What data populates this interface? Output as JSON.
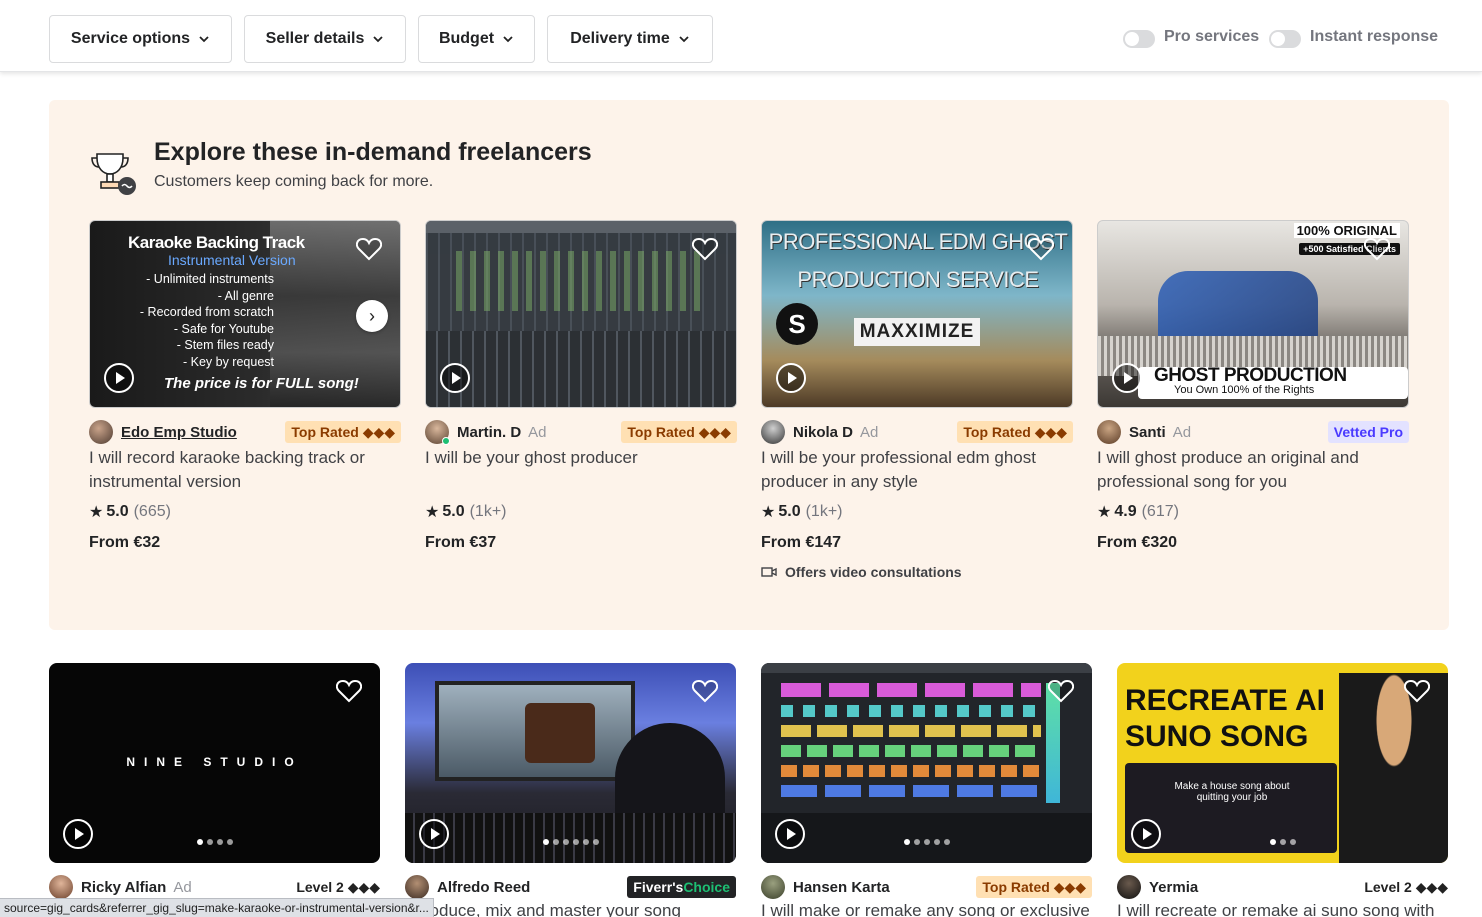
{
  "filters": {
    "service_options": "Service options",
    "seller_details": "Seller details",
    "budget": "Budget",
    "delivery_time": "Delivery time",
    "pro_services": "Pro services",
    "instant_response": "Instant response"
  },
  "promo": {
    "title": "Explore these in-demand freelancers",
    "subtitle": "Customers keep coming back for more.",
    "cards": [
      {
        "thumb_lines": [
          "Karaoke Backing Track",
          "Instrumental Version",
          "- Unlimited instruments",
          "- All genre",
          "- Recorded from scratch",
          "- Safe for Youtube",
          "- Stem files ready",
          "- Key by request",
          "The price is for FULL song!"
        ],
        "seller": "Edo Emp Studio",
        "ad": "",
        "badge": "Top Rated ◆◆◆",
        "title": "I will record karaoke backing track or instrumental version",
        "rating": "5.0",
        "count": "(665)",
        "price": "From €32"
      },
      {
        "seller": "Martin. D",
        "ad": "Ad",
        "badge": "Top Rated ◆◆◆",
        "title": "I will be your ghost producer",
        "rating": "5.0",
        "count": "(1k+)",
        "price": "From €37"
      },
      {
        "thumb_lines": [
          "PROFESSIONAL EDM GHOST",
          "PRODUCTION SERVICE",
          "MAXXIMIZE"
        ],
        "seller": "Nikola D",
        "ad": "Ad",
        "badge": "Top Rated ◆◆◆",
        "title": "I will be your professional edm ghost producer in any style",
        "rating": "5.0",
        "count": "(1k+)",
        "price": "From €147",
        "consult": "Offers video consultations"
      },
      {
        "thumb_lines": [
          "100% ORIGINAL",
          "+500 Satisfied Clients",
          "GHOST PRODUCTION",
          "You Own 100% of the Rights"
        ],
        "seller": "Santi",
        "ad": "Ad",
        "badge": "Vetted Pro",
        "title": "I will ghost produce an original and professional song for you",
        "rating": "4.9",
        "count": "(617)",
        "price": "From €320"
      }
    ]
  },
  "grid": [
    {
      "thumb_text": "NINE STUDIO",
      "seller": "Ricky Alfian",
      "ad": "Ad",
      "badge": "Level 2 ◆◆◆"
    },
    {
      "seller": "Alfredo Reed",
      "ad": "",
      "badge_pre": "Fiverr's",
      "badge_post": " Choice",
      "title": "I produce, mix and master your song"
    },
    {
      "seller": "Hansen Karta",
      "ad": "",
      "badge": "Top Rated ◆◆◆",
      "title": "I will make or remake any song or exclusive"
    },
    {
      "thumb_lines": [
        "RECREATE AI",
        "SUNO SONG",
        "Make a house song about quitting your job"
      ],
      "seller": "Yermia",
      "ad": "",
      "badge": "Level 2 ◆◆◆",
      "title": "I will recreate or remake ai suno song with"
    }
  ],
  "statusbar": "source=gig_cards&referrer_gig_slug=make-karaoke-or-instrumental-version&r..."
}
